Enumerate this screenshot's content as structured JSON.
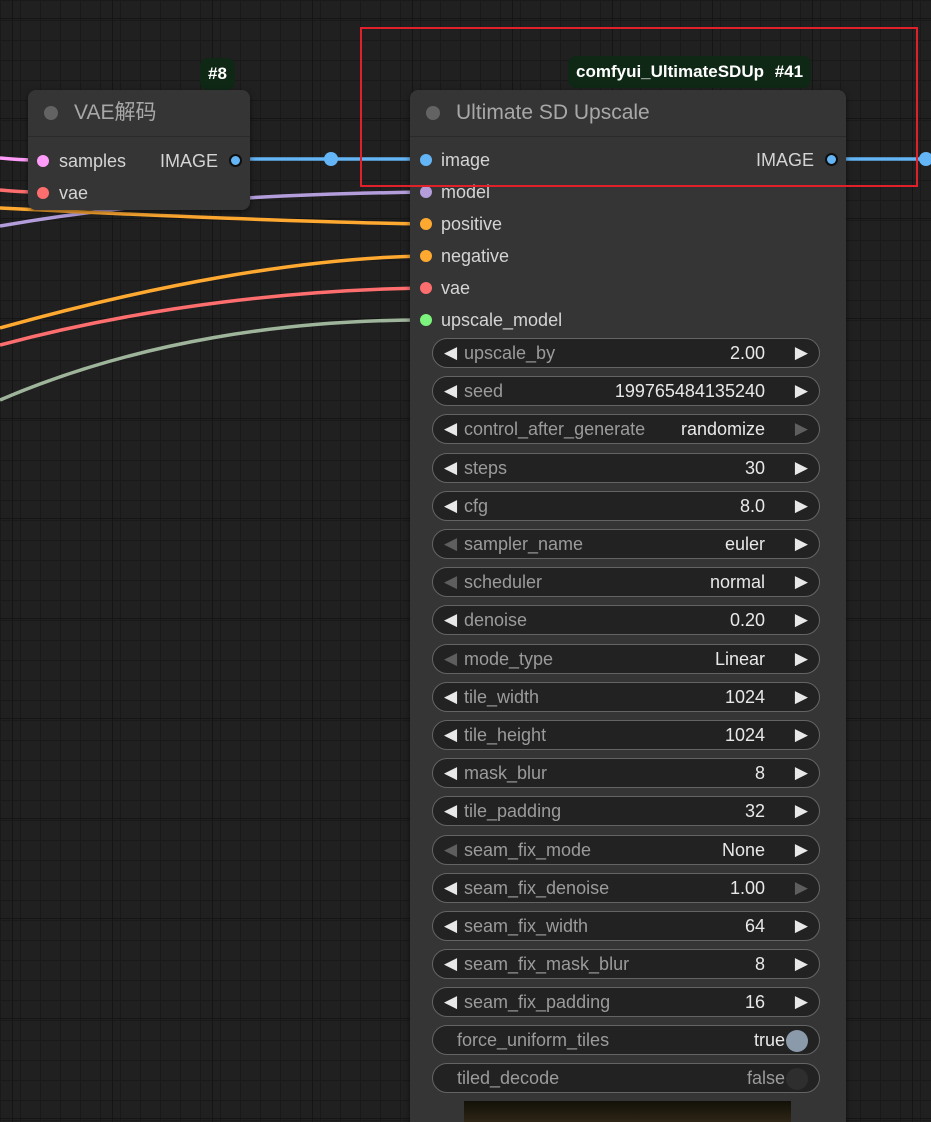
{
  "vae_node": {
    "badge": "#8",
    "title": "VAE解码",
    "inputs": [
      {
        "name": "samples",
        "color": "#ff9cf9"
      },
      {
        "name": "vae",
        "color": "#ff6e6e"
      }
    ],
    "output": {
      "name": "IMAGE",
      "color": "#64b5f6"
    }
  },
  "upscale_node": {
    "badge_name": "comfyui_UltimateSDUp",
    "badge_id": "#41",
    "title": "Ultimate SD Upscale",
    "inputs": [
      {
        "name": "image",
        "color": "#64b5f6"
      },
      {
        "name": "model",
        "color": "#b39ddb"
      },
      {
        "name": "positive",
        "color": "#ffa931"
      },
      {
        "name": "negative",
        "color": "#ffa931"
      },
      {
        "name": "vae",
        "color": "#ff6e6e"
      },
      {
        "name": "upscale_model",
        "color": "#7cf37c"
      }
    ],
    "output": {
      "name": "IMAGE",
      "color": "#64b5f6"
    },
    "widgets": [
      {
        "label": "upscale_by",
        "value": "2.00",
        "left_active": true,
        "right_active": true
      },
      {
        "label": "seed",
        "value": "199765484135240",
        "left_active": true,
        "right_active": true
      },
      {
        "label": "control_after_generate",
        "value": "randomize",
        "left_active": true,
        "right_active": false
      },
      {
        "label": "steps",
        "value": "30",
        "left_active": true,
        "right_active": true
      },
      {
        "label": "cfg",
        "value": "8.0",
        "left_active": true,
        "right_active": true
      },
      {
        "label": "sampler_name",
        "value": "euler",
        "left_active": false,
        "right_active": true
      },
      {
        "label": "scheduler",
        "value": "normal",
        "left_active": false,
        "right_active": true
      },
      {
        "label": "denoise",
        "value": "0.20",
        "left_active": true,
        "right_active": true
      },
      {
        "label": "mode_type",
        "value": "Linear",
        "left_active": false,
        "right_active": true
      },
      {
        "label": "tile_width",
        "value": "1024",
        "left_active": true,
        "right_active": true
      },
      {
        "label": "tile_height",
        "value": "1024",
        "left_active": true,
        "right_active": true
      },
      {
        "label": "mask_blur",
        "value": "8",
        "left_active": true,
        "right_active": true
      },
      {
        "label": "tile_padding",
        "value": "32",
        "left_active": true,
        "right_active": true
      },
      {
        "label": "seam_fix_mode",
        "value": "None",
        "left_active": false,
        "right_active": true
      },
      {
        "label": "seam_fix_denoise",
        "value": "1.00",
        "left_active": true,
        "right_active": false
      },
      {
        "label": "seam_fix_width",
        "value": "64",
        "left_active": true,
        "right_active": true
      },
      {
        "label": "seam_fix_mask_blur",
        "value": "8",
        "left_active": true,
        "right_active": true
      },
      {
        "label": "seam_fix_padding",
        "value": "16",
        "left_active": true,
        "right_active": true
      }
    ],
    "toggles": [
      {
        "label": "force_uniform_tiles",
        "value": "true",
        "on": true
      },
      {
        "label": "tiled_decode",
        "value": "false",
        "on": false
      }
    ]
  },
  "icons": {
    "arrow_left": "◀",
    "arrow_right": "▶"
  },
  "colors": {
    "highlight": "#e0212b",
    "link_image": "#64b5f6",
    "link_model": "#b39ddb",
    "link_conditioning": "#ffa931",
    "link_vae": "#ff6e6e",
    "link_upscale_model": "#9fb59b"
  }
}
